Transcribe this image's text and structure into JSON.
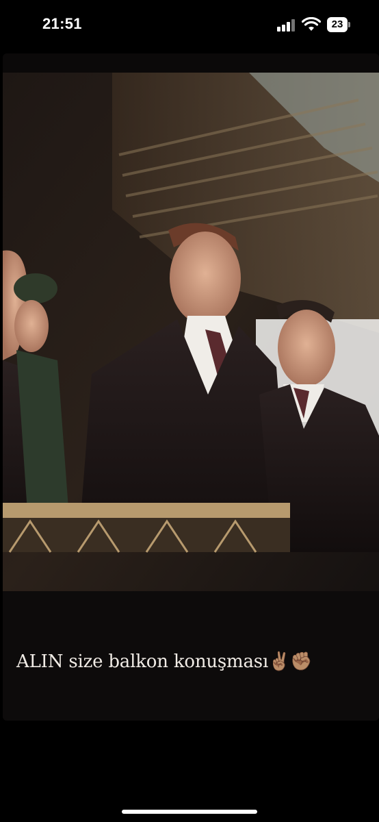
{
  "status_bar": {
    "time": "21:51",
    "battery": "23"
  },
  "story": {
    "caption": "ALIN size balkon konuşması✌🏽✊🏽"
  }
}
